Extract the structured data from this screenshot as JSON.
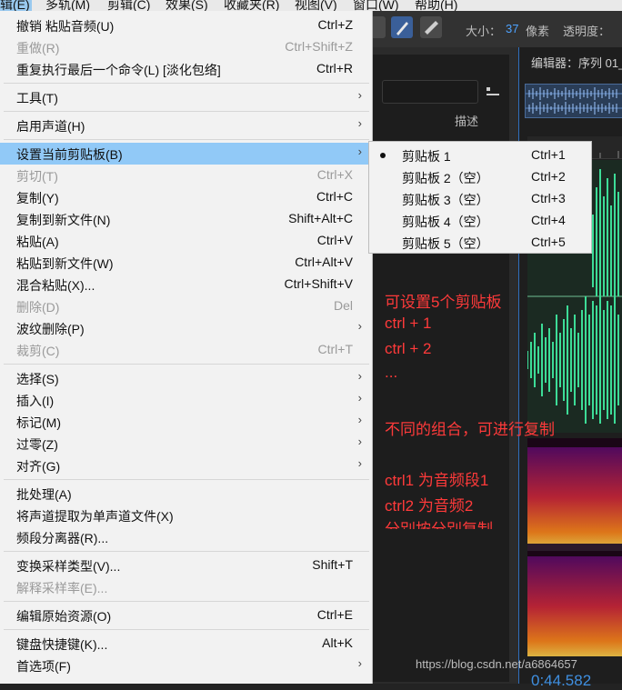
{
  "menubar": [
    "辑(E)",
    "多轨(M)",
    "剪辑(C)",
    "效果(S)",
    "收藏夹(R)",
    "视图(V)",
    "窗口(W)",
    "帮助(H)"
  ],
  "menu": [
    {
      "label": "撤销 粘贴音频(U)",
      "shortcut": "Ctrl+Z"
    },
    {
      "label": "重做(R)",
      "shortcut": "Ctrl+Shift+Z",
      "disabled": true
    },
    {
      "label": "重复执行最后一个命令(L) [淡化包络]",
      "shortcut": "Ctrl+R"
    },
    {
      "label": "工具(T)",
      "submenu": true
    },
    {
      "label": "启用声道(H)",
      "submenu": true
    },
    {
      "label": "设置当前剪贴板(B)",
      "submenu": true,
      "highlighted": true
    },
    {
      "label": "剪切(T)",
      "shortcut": "Ctrl+X",
      "disabled": true
    },
    {
      "label": "复制(Y)",
      "shortcut": "Ctrl+C"
    },
    {
      "label": "复制到新文件(N)",
      "shortcut": "Shift+Alt+C"
    },
    {
      "label": "粘贴(A)",
      "shortcut": "Ctrl+V"
    },
    {
      "label": "粘贴到新文件(W)",
      "shortcut": "Ctrl+Alt+V"
    },
    {
      "label": "混合粘贴(X)...",
      "shortcut": "Ctrl+Shift+V"
    },
    {
      "label": "删除(D)",
      "shortcut": "Del",
      "disabled": true
    },
    {
      "label": "波纹删除(P)",
      "submenu": true
    },
    {
      "label": "裁剪(C)",
      "shortcut": "Ctrl+T",
      "disabled": true
    },
    {
      "label": "选择(S)",
      "submenu": true
    },
    {
      "label": "插入(I)",
      "submenu": true
    },
    {
      "label": "标记(M)",
      "submenu": true
    },
    {
      "label": "过零(Z)",
      "submenu": true
    },
    {
      "label": "对齐(G)",
      "submenu": true
    },
    {
      "label": "批处理(A)"
    },
    {
      "label": "将声道提取为单声道文件(X)"
    },
    {
      "label": "频段分离器(R)..."
    },
    {
      "label": "变换采样类型(V)...",
      "shortcut": "Shift+T"
    },
    {
      "label": "解释采样率(E)...",
      "disabled": true
    },
    {
      "label": "编辑原始资源(O)",
      "shortcut": "Ctrl+E"
    },
    {
      "label": "键盘快捷键(K)...",
      "shortcut": "Alt+K"
    },
    {
      "label": "首选项(F)",
      "submenu": true
    }
  ],
  "submenu": [
    {
      "label": "剪贴板 1",
      "shortcut": "Ctrl+1",
      "checked": true
    },
    {
      "label": "剪贴板 2（空）",
      "shortcut": "Ctrl+2"
    },
    {
      "label": "剪贴板 3（空）",
      "shortcut": "Ctrl+3"
    },
    {
      "label": "剪贴板 4（空）",
      "shortcut": "Ctrl+4"
    },
    {
      "label": "剪贴板 5（空）",
      "shortcut": "Ctrl+5"
    }
  ],
  "toolbar": {
    "size_label": "大小：",
    "size_value": "37",
    "size_unit": "像素",
    "opacity_label": "透明度："
  },
  "editor_title": "编辑器：序列 01_",
  "desc_label": "描述",
  "timecode": "0:44.582",
  "annotation": [
    "可设置5个剪贴板",
    "ctrl + 1",
    "ctrl + 2",
    "...",
    "不同的组合，可进行复制",
    "ctrl1 为音频段1",
    "ctrl2 为音频2",
    "分别按分别复制"
  ],
  "watermark": "https://blog.csdn.net/a6864657",
  "colors": {
    "highlight": "#91c9f7",
    "annotation": "#ff3a3a",
    "waveform": "#3ddc97",
    "accent": "#2f6fbd"
  }
}
